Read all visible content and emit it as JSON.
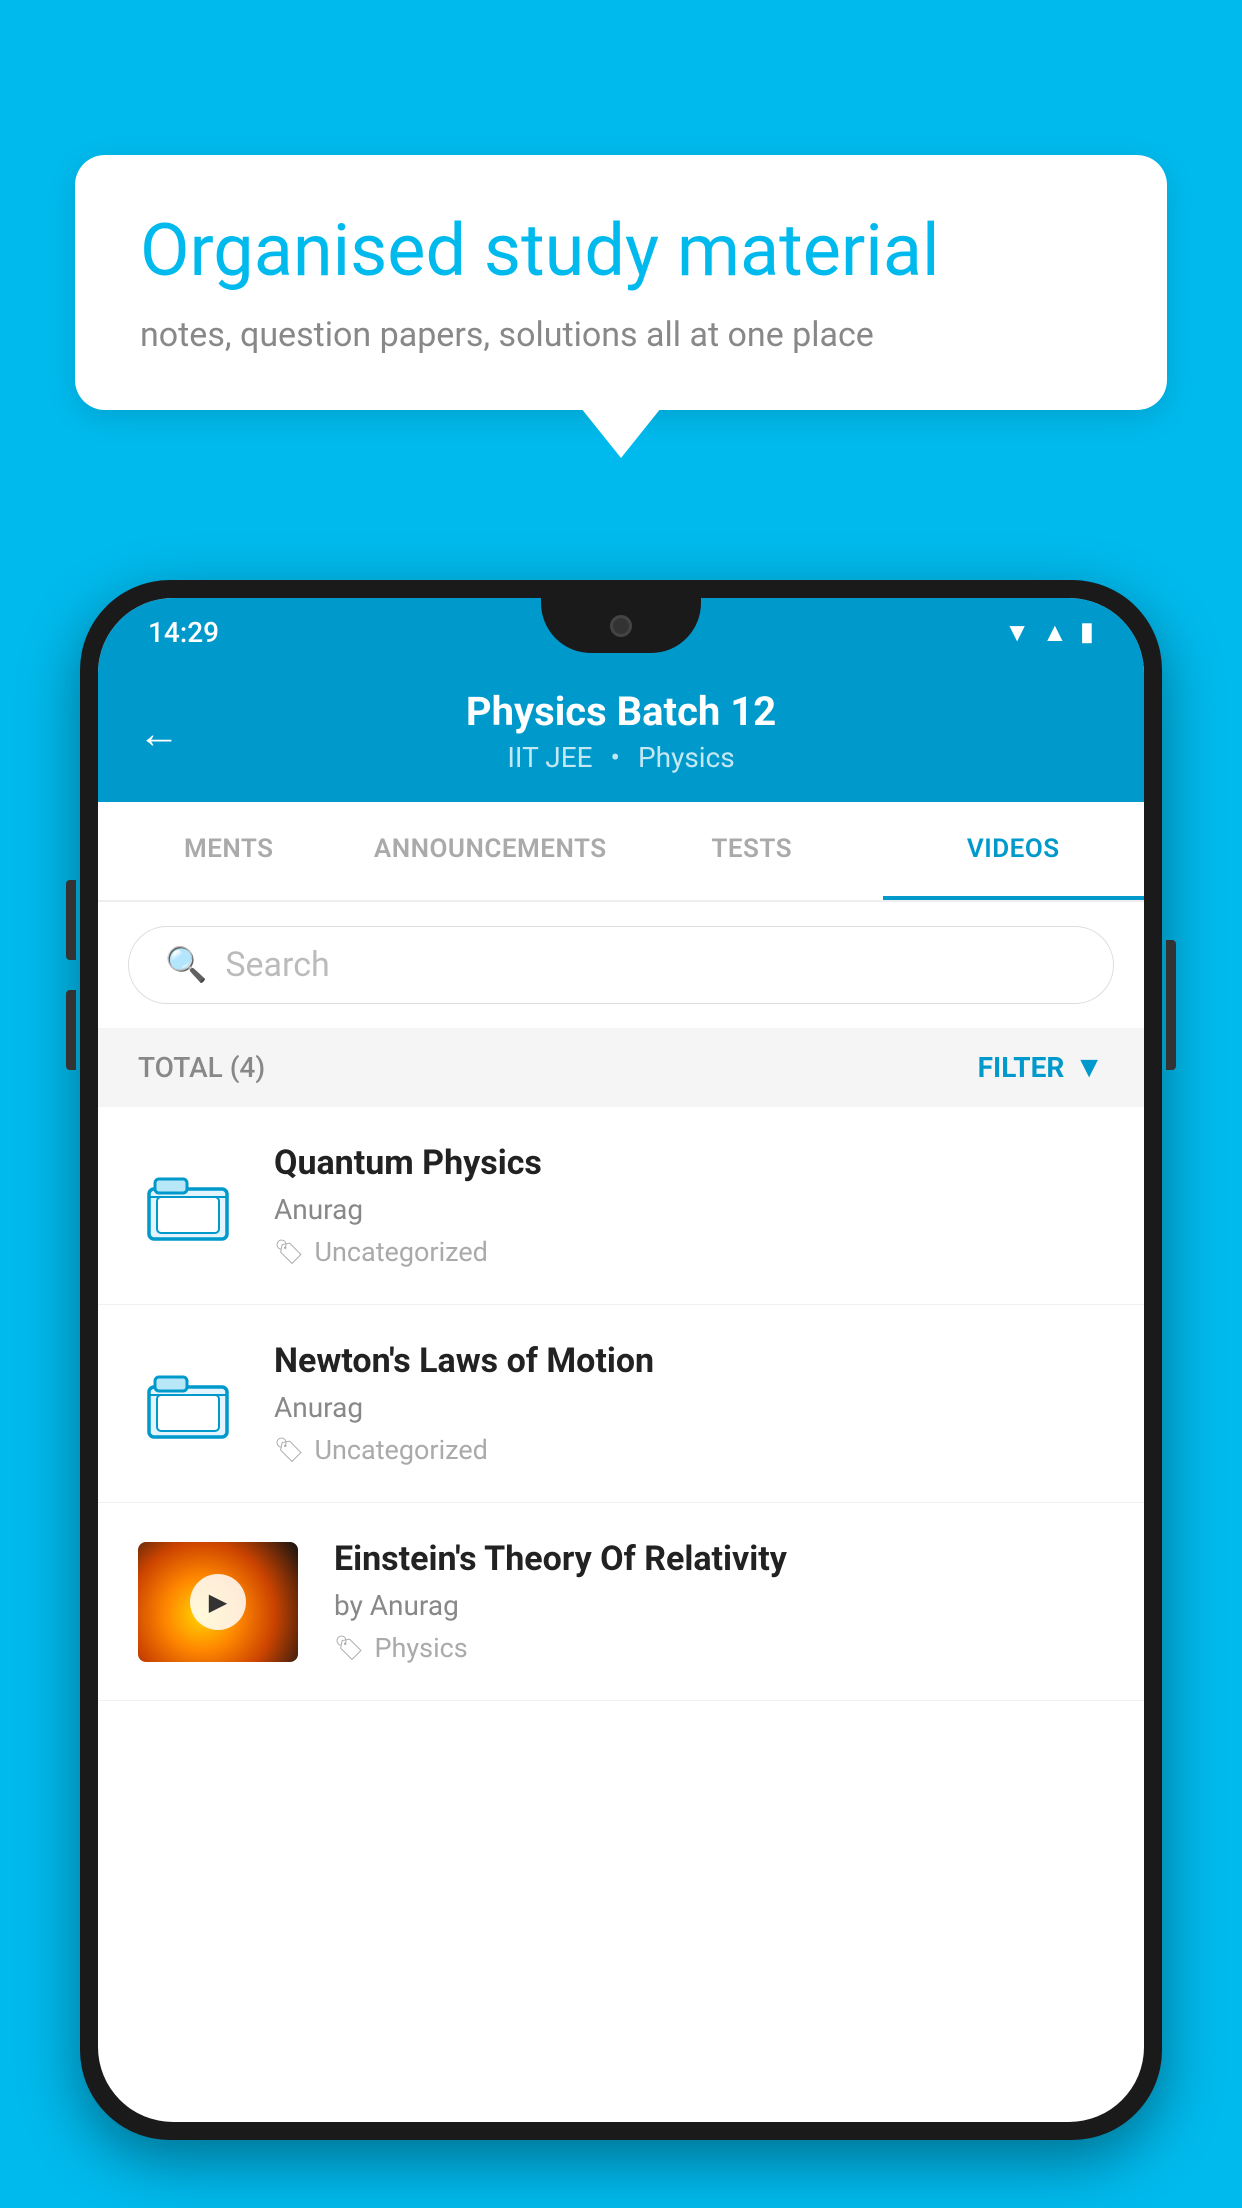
{
  "background_color": "#00BAED",
  "speech_bubble": {
    "title": "Organised study material",
    "subtitle": "notes, question papers, solutions all at one place"
  },
  "status_bar": {
    "time": "14:29"
  },
  "app_header": {
    "back_label": "←",
    "title": "Physics Batch 12",
    "subtitle_parts": [
      "IIT JEE",
      "Physics"
    ]
  },
  "tabs": [
    {
      "label": "MENTS",
      "active": false
    },
    {
      "label": "ANNOUNCEMENTS",
      "active": false
    },
    {
      "label": "TESTS",
      "active": false
    },
    {
      "label": "VIDEOS",
      "active": true
    }
  ],
  "search": {
    "placeholder": "Search"
  },
  "filter_bar": {
    "total_label": "TOTAL (4)",
    "filter_label": "FILTER"
  },
  "video_items": [
    {
      "type": "folder",
      "title": "Quantum Physics",
      "author": "Anurag",
      "tag": "Uncategorized"
    },
    {
      "type": "folder",
      "title": "Newton's Laws of Motion",
      "author": "Anurag",
      "tag": "Uncategorized"
    },
    {
      "type": "video",
      "title": "Einstein's Theory Of Relativity",
      "author": "by Anurag",
      "tag": "Physics"
    }
  ]
}
